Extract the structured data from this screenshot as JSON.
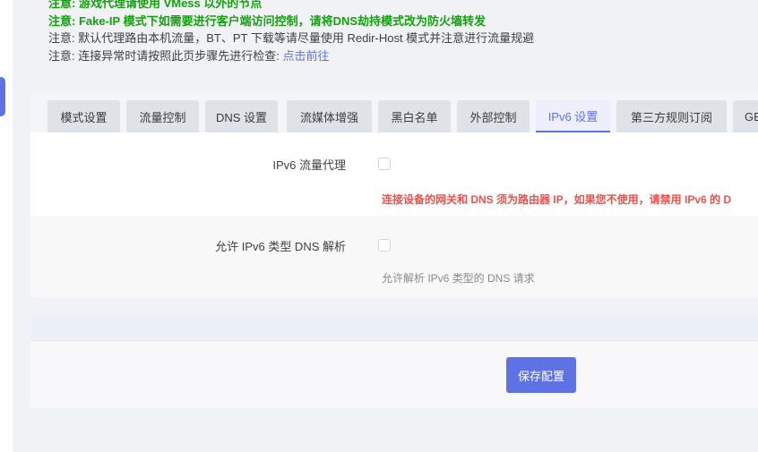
{
  "notes": [
    {
      "prefix": "注意: ",
      "text": "游戏代理请使用 VMess 以外的节点",
      "style": "green"
    },
    {
      "prefix": "注意: ",
      "text": "Fake-IP 模式下如需要进行客户端访问控制，请将DNS劫持模式改为防火墙转发",
      "style": "green"
    },
    {
      "prefix": "注意: ",
      "text": "默认代理路由本机流量，BT、PT 下载等请尽量使用 Redir-Host 模式并注意进行流量规避",
      "style": "normal"
    },
    {
      "prefix": "注意: ",
      "text": "连接异常时请按照此页步骤先进行检查: ",
      "link": "点击前往",
      "style": "normal"
    }
  ],
  "tabs": [
    {
      "label": "模式设置",
      "active": false
    },
    {
      "label": "流量控制",
      "active": false
    },
    {
      "label": "DNS 设置",
      "active": false
    },
    {
      "label": "流媒体增强",
      "active": false
    },
    {
      "label": "黑白名单",
      "active": false
    },
    {
      "label": "外部控制",
      "active": false
    },
    {
      "label": "IPv6 设置",
      "active": true
    },
    {
      "label": "第三方规则订阅",
      "active": false
    },
    {
      "label": "GE",
      "active": false
    }
  ],
  "settings": {
    "ipv6_proxy": {
      "label": "IPv6 流量代理",
      "checked": false,
      "warning": "连接设备的网关和 DNS 须为路由器 IP，如果您不使用，请禁用 IPv6 的 D"
    },
    "ipv6_dns": {
      "label": "允许 IPv6 类型 DNS 解析",
      "checked": false,
      "hint": "允许解析 IPv6 类型的 DNS 请求"
    }
  },
  "actions": {
    "save_label": "保存配置"
  },
  "colors": {
    "accent": "#5e72e4",
    "note_green": "#13a10e",
    "warning_red": "#f0504b"
  }
}
